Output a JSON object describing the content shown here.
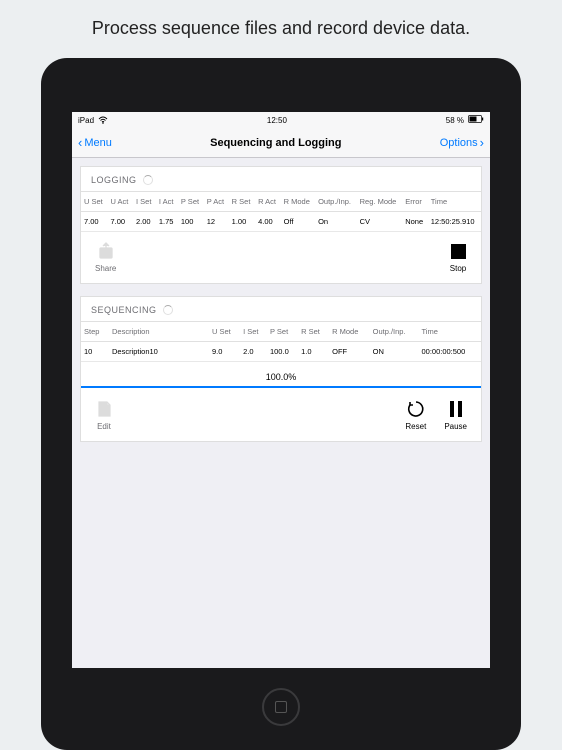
{
  "headline": "Process sequence files and record device data.",
  "status": {
    "carrier": "iPad",
    "time": "12:50",
    "battery": "58 %"
  },
  "nav": {
    "back": "Menu",
    "title": "Sequencing and Logging",
    "right": "Options"
  },
  "logging": {
    "title": "LOGGING",
    "cols": [
      "U Set",
      "U Act",
      "I Set",
      "I Act",
      "P Set",
      "P Act",
      "R Set",
      "R Act",
      "R Mode",
      "Outp./Inp.",
      "Reg. Mode",
      "Error",
      "Time"
    ],
    "row": [
      "7.00",
      "7.00",
      "2.00",
      "1.75",
      "100",
      "12",
      "1.00",
      "4.00",
      "Off",
      "On",
      "CV",
      "None",
      "12:50:25.910"
    ],
    "share": "Share",
    "stop": "Stop"
  },
  "sequencing": {
    "title": "SEQUENCING",
    "cols": [
      "Step",
      "Description",
      "U Set",
      "I Set",
      "P Set",
      "R Set",
      "R Mode",
      "Outp./Inp.",
      "Time"
    ],
    "row": [
      "10",
      "Description10",
      "9.0",
      "2.0",
      "100.0",
      "1.0",
      "OFF",
      "ON",
      "00:00:00:500"
    ],
    "progress": "100.0%",
    "edit": "Edit",
    "reset": "Reset",
    "pause": "Pause"
  }
}
